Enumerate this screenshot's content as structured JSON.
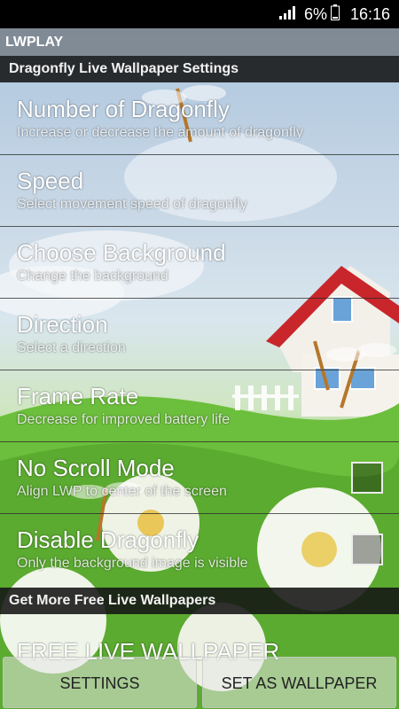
{
  "status_bar": {
    "battery_percent": "6%",
    "time": "16:16",
    "icons": [
      "signal-icon",
      "battery-icon"
    ]
  },
  "app": {
    "title": "LWPLAY"
  },
  "sections": {
    "settings_header": "Dragonfly Live Wallpaper Settings",
    "more_header": "Get More Free Live Wallpapers"
  },
  "preferences": [
    {
      "title": "Number of Dragonfly",
      "summary": "Increase or decrease the amount of dragonfly"
    },
    {
      "title": "Speed",
      "summary": "Select movement speed of dragonfly"
    },
    {
      "title": "Choose Background",
      "summary": "Change the background"
    },
    {
      "title": "Direction",
      "summary": "Select a direction"
    },
    {
      "title": "Frame Rate",
      "summary": "Decrease for improved battery life"
    },
    {
      "title": "No Scroll Mode",
      "summary": "Align LWP to center of the screen",
      "checked": false
    },
    {
      "title": "Disable Dragonfly",
      "summary": "Only the background image is visible",
      "checked": false
    }
  ],
  "free_wallpaper": {
    "label": "FREE LIVE WALLPAPER"
  },
  "buttons": {
    "settings": "SETTINGS",
    "set_as_wallpaper": "SET AS WALLPAPER"
  }
}
